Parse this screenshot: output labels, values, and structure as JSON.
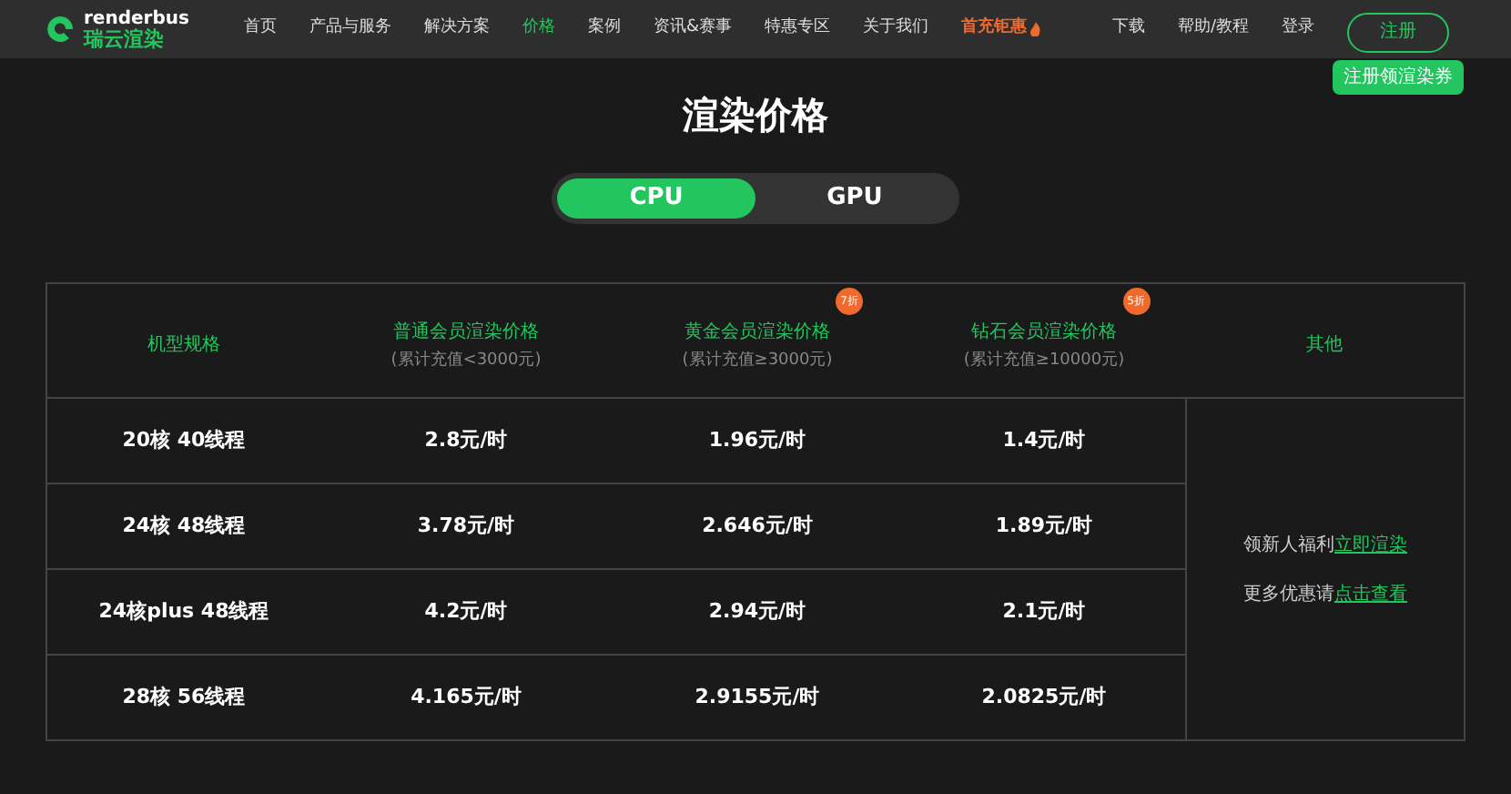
{
  "logo": {
    "name": "renderbus",
    "subtitle": "瑞云渲染"
  },
  "nav": [
    {
      "label": "首页",
      "selected": false,
      "kind": "plain"
    },
    {
      "label": "产品与服务",
      "selected": false,
      "kind": "plain"
    },
    {
      "label": "解决方案",
      "selected": false,
      "kind": "plain"
    },
    {
      "label": "价格",
      "selected": true,
      "kind": "plain"
    },
    {
      "label": "案例",
      "selected": false,
      "kind": "plain"
    },
    {
      "label": "资讯&赛事",
      "selected": false,
      "kind": "plain"
    },
    {
      "label": "特惠专区",
      "selected": false,
      "kind": "plain"
    },
    {
      "label": "关于我们",
      "selected": false,
      "kind": "plain"
    },
    {
      "label": "首充钜惠",
      "selected": false,
      "kind": "promo"
    }
  ],
  "nav_right": [
    "下载",
    "帮助/教程",
    "登录"
  ],
  "register": {
    "label": "注册",
    "tooltip": "注册领渲染券"
  },
  "title": "渲染价格",
  "toggle": [
    {
      "label": "CPU",
      "selected": true
    },
    {
      "label": "GPU",
      "selected": false
    }
  ],
  "table": {
    "columns": [
      {
        "title": "机型规格"
      },
      {
        "title": "普通会员渲染价格",
        "subtitle": "(累计充值<3000元)"
      },
      {
        "title": "黄金会员渲染价格",
        "subtitle": "(累计充值≥3000元)",
        "badge": "7折"
      },
      {
        "title": "钻石会员渲染价格",
        "subtitle": "(累计充值≥10000元)",
        "badge": "5折"
      },
      {
        "title": "其他"
      }
    ],
    "rows": [
      [
        "20核 40线程",
        "2.8元/时",
        "1.96元/时",
        "1.4元/时"
      ],
      [
        "24核 48线程",
        "3.78元/时",
        "2.646元/时",
        "1.89元/时"
      ],
      [
        "24核plus 48线程",
        "4.2元/时",
        "2.94元/时",
        "2.1元/时"
      ],
      [
        "28核 56线程",
        "4.165元/时",
        "2.9155元/时",
        "2.0825元/时"
      ]
    ],
    "other": [
      {
        "text": "领新人福利",
        "link": "立即渲染"
      },
      {
        "text": "更多优惠请",
        "link": "点击查看"
      }
    ]
  }
}
